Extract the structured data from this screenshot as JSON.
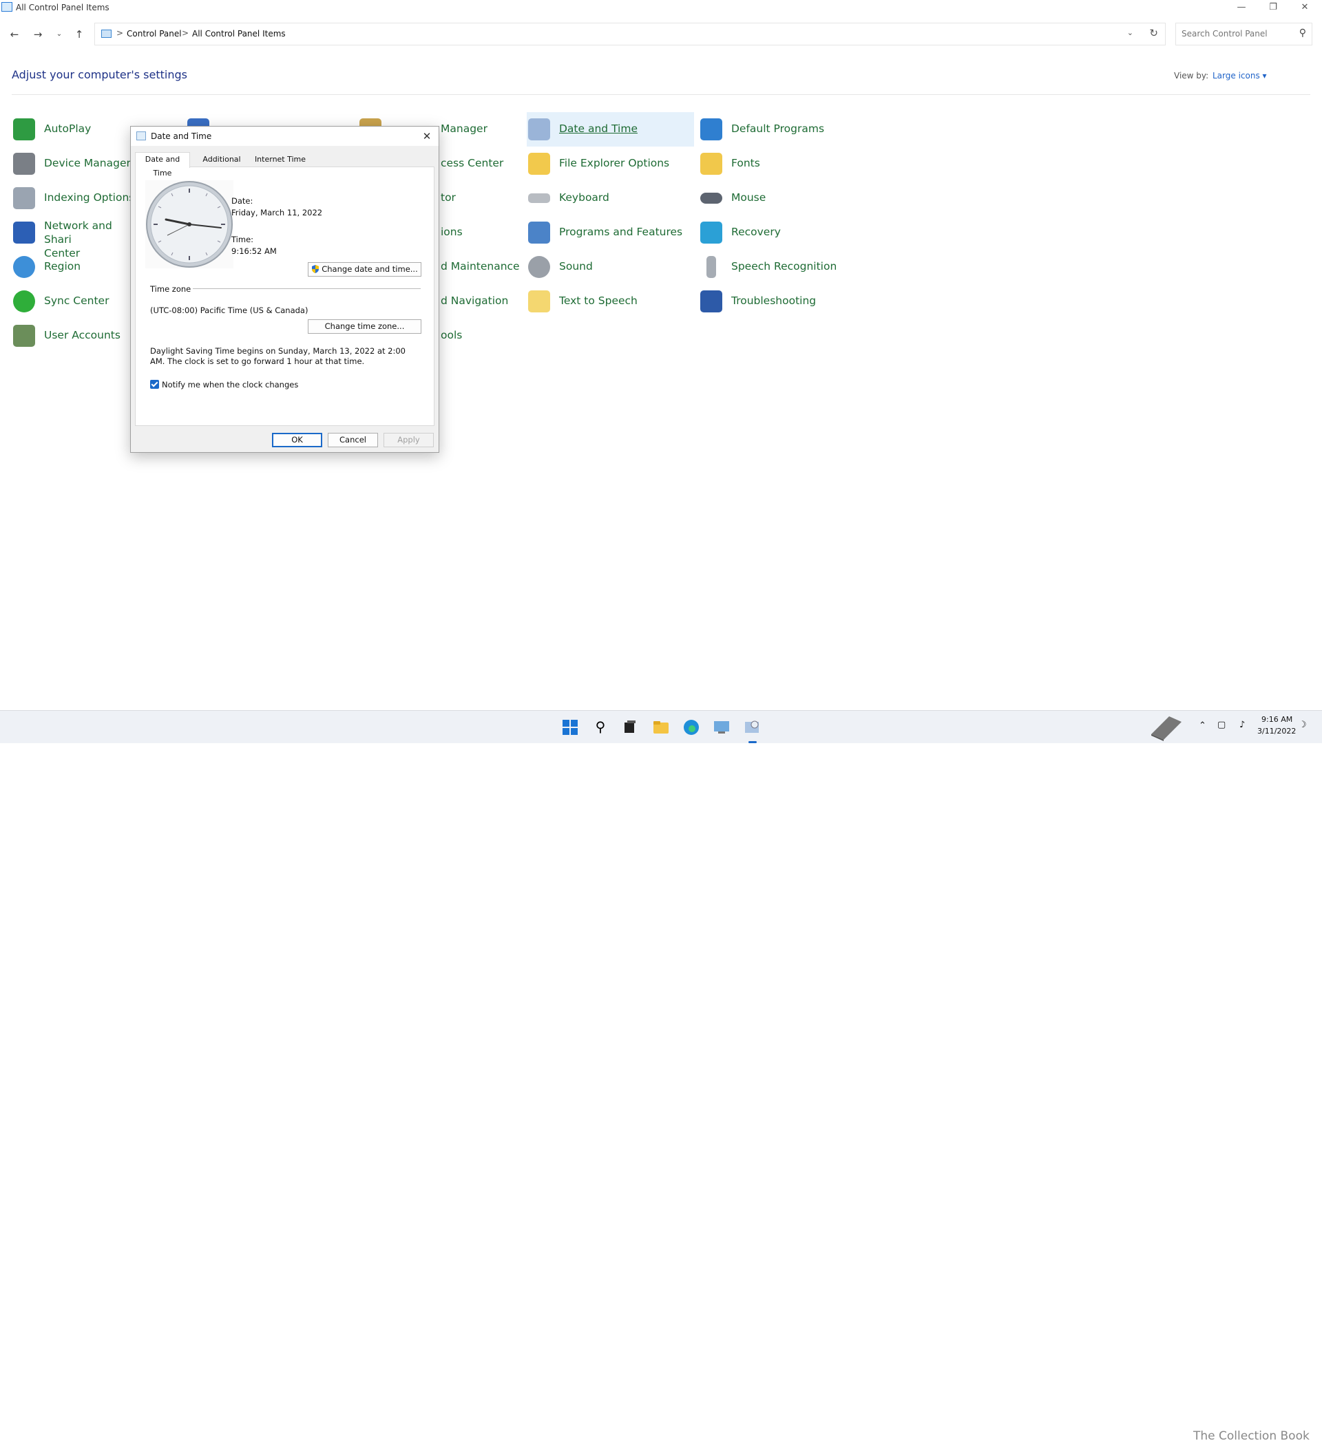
{
  "window": {
    "title": "All Control Panel Items"
  },
  "address": {
    "crumbs": [
      "Control Panel",
      "All Control Panel Items"
    ],
    "separator": ">"
  },
  "search": {
    "placeholder": "Search Control Panel"
  },
  "header": {
    "title": "Adjust your computer's settings",
    "view_by_label": "View by:",
    "view_by_value": "Large icons ▾"
  },
  "items": [
    {
      "label": "AutoPlay",
      "icon": "autoplay-icon"
    },
    {
      "label": "Device Manager",
      "icon": "device-manager-icon"
    },
    {
      "label": "Indexing Options",
      "icon": "indexing-icon"
    },
    {
      "label": "Network and Shari\nCenter",
      "icon": "network-icon"
    },
    {
      "label": "Region",
      "icon": "region-icon"
    },
    {
      "label": "Sync Center",
      "icon": "sync-icon"
    },
    {
      "label": "User Accounts",
      "icon": "user-accounts-icon"
    },
    {
      "label": "Manager",
      "icon": "credential-manager-icon"
    },
    {
      "label": "cess Center",
      "icon": "ease-of-access-icon"
    },
    {
      "label": "tor",
      "icon": "indexing-partial-icon"
    },
    {
      "label": "ions",
      "icon": "options-partial-icon"
    },
    {
      "label": "d Maintenance",
      "icon": "security-maintenance-icon"
    },
    {
      "label": "d Navigation",
      "icon": "taskbar-navigation-icon"
    },
    {
      "label": "ools",
      "icon": "tools-partial-icon"
    },
    {
      "label": "Date and Time",
      "icon": "date-time-icon"
    },
    {
      "label": "File Explorer Options",
      "icon": "folder-options-icon"
    },
    {
      "label": "Keyboard",
      "icon": "keyboard-icon"
    },
    {
      "label": "Programs and Features",
      "icon": "programs-icon"
    },
    {
      "label": "Sound",
      "icon": "sound-icon"
    },
    {
      "label": "Text to Speech",
      "icon": "text-to-speech-icon"
    },
    {
      "label": "Default Programs",
      "icon": "default-programs-icon"
    },
    {
      "label": "Fonts",
      "icon": "fonts-icon"
    },
    {
      "label": "Mouse",
      "icon": "mouse-icon"
    },
    {
      "label": "Recovery",
      "icon": "recovery-icon"
    },
    {
      "label": "Speech Recognition",
      "icon": "microphone-icon"
    },
    {
      "label": "Troubleshooting",
      "icon": "troubleshooting-icon"
    }
  ],
  "dialog": {
    "title": "Date and Time",
    "tabs": [
      "Date and Time",
      "Additional Clocks",
      "Internet Time"
    ],
    "date_label": "Date:",
    "date_value": "Friday, March 11, 2022",
    "time_label": "Time:",
    "time_value": "9:16:52 AM",
    "change_datetime_button": "Change date and time...",
    "timezone_heading": "Time zone",
    "timezone_value": "(UTC-08:00) Pacific Time (US & Canada)",
    "change_timezone_button": "Change time zone...",
    "dst_text": "Daylight Saving Time begins on Sunday, March 13, 2022 at 2:00 AM. The clock is set to go forward 1 hour at that time.",
    "notify_label": "Notify me when the clock changes",
    "notify_checked": true,
    "ok": "OK",
    "cancel": "Cancel",
    "apply": "Apply"
  },
  "taskbar": {
    "time": "9:16 AM",
    "date": "3/11/2022",
    "watermark": "The Collection Book"
  },
  "colors": {
    "link_green": "#1e6b34",
    "title_blue": "#1e3287",
    "accent": "#1a69c9",
    "selected_bg": "#e5f1fb"
  }
}
